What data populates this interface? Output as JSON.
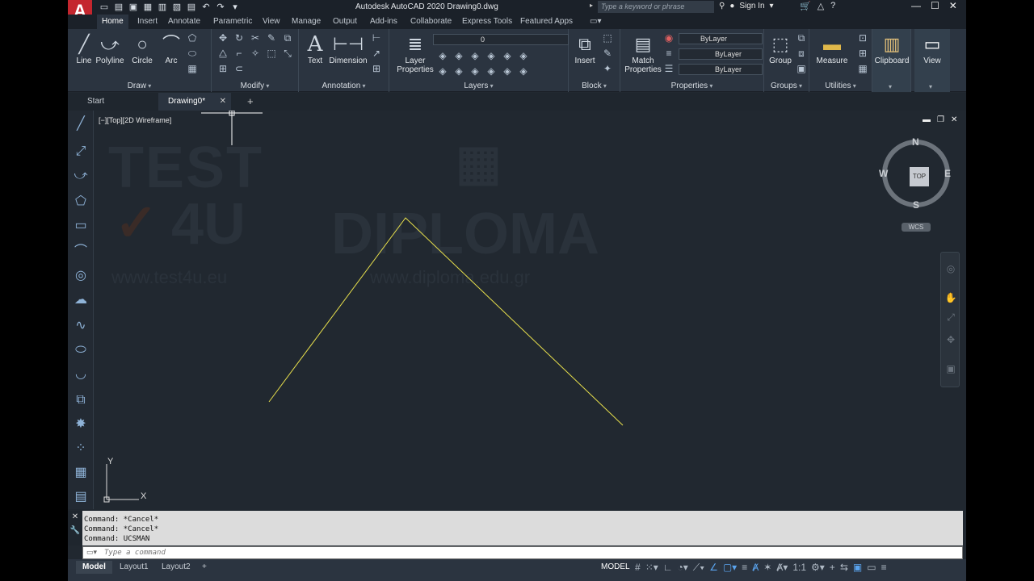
{
  "app": {
    "logo_letter": "A",
    "title": "Autodesk AutoCAD 2020   Drawing0.dwg",
    "search_placeholder": "Type a keyword or phrase",
    "sign_in": "Sign In"
  },
  "ribbon": {
    "tabs": [
      "Home",
      "Insert",
      "Annotate",
      "Parametric",
      "View",
      "Manage",
      "Output",
      "Add-ins",
      "Collaborate",
      "Express Tools",
      "Featured Apps"
    ],
    "draw": {
      "title": "Draw",
      "line": "Line",
      "polyline": "Polyline",
      "circle": "Circle",
      "arc": "Arc"
    },
    "modify": {
      "title": "Modify"
    },
    "annotation": {
      "title": "Annotation",
      "text": "Text",
      "dimension": "Dimension"
    },
    "layers": {
      "title": "Layers",
      "layer_properties_1": "Layer",
      "layer_properties_2": "Properties",
      "current_layer": "0"
    },
    "block": {
      "title": "Block",
      "insert": "Insert"
    },
    "properties": {
      "title": "Properties",
      "match_1": "Match",
      "match_2": "Properties",
      "color": "ByLayer",
      "linetype": "ByLayer",
      "lineweight": "ByLayer"
    },
    "groups": {
      "title": "Groups",
      "group": "Group"
    },
    "utilities": {
      "title": "Utilities",
      "measure": "Measure"
    },
    "clipboard": {
      "title": "Clipboard"
    },
    "view": {
      "title": "View"
    }
  },
  "doc_tabs": {
    "start": "Start",
    "drawing": "Drawing0*"
  },
  "viewport": {
    "label": "[−][Top][2D Wireframe]",
    "viewcube": {
      "top": "TOP",
      "n": "N",
      "s": "S",
      "e": "E",
      "w": "W",
      "wcs": "WCS"
    },
    "ucs": {
      "x": "X",
      "y": "Y"
    }
  },
  "watermark": {
    "line1": "TEST",
    "line2": "4U",
    "url1": "www.test4u.eu",
    "brand": "DIPLOMA",
    "url2": "www.diploma.edu.gr"
  },
  "command": {
    "history": [
      "Command: *Cancel*",
      "Command: *Cancel*",
      "Command: UCSMAN"
    ],
    "placeholder": "Type a command"
  },
  "status": {
    "layout_tabs": [
      "Model",
      "Layout1",
      "Layout2"
    ],
    "model": "MODEL",
    "scale": "1:1"
  },
  "colors": {
    "background": "#212830",
    "line": "#e8e04c",
    "ribbon": "#2b3440",
    "logo": "#c4262e"
  }
}
